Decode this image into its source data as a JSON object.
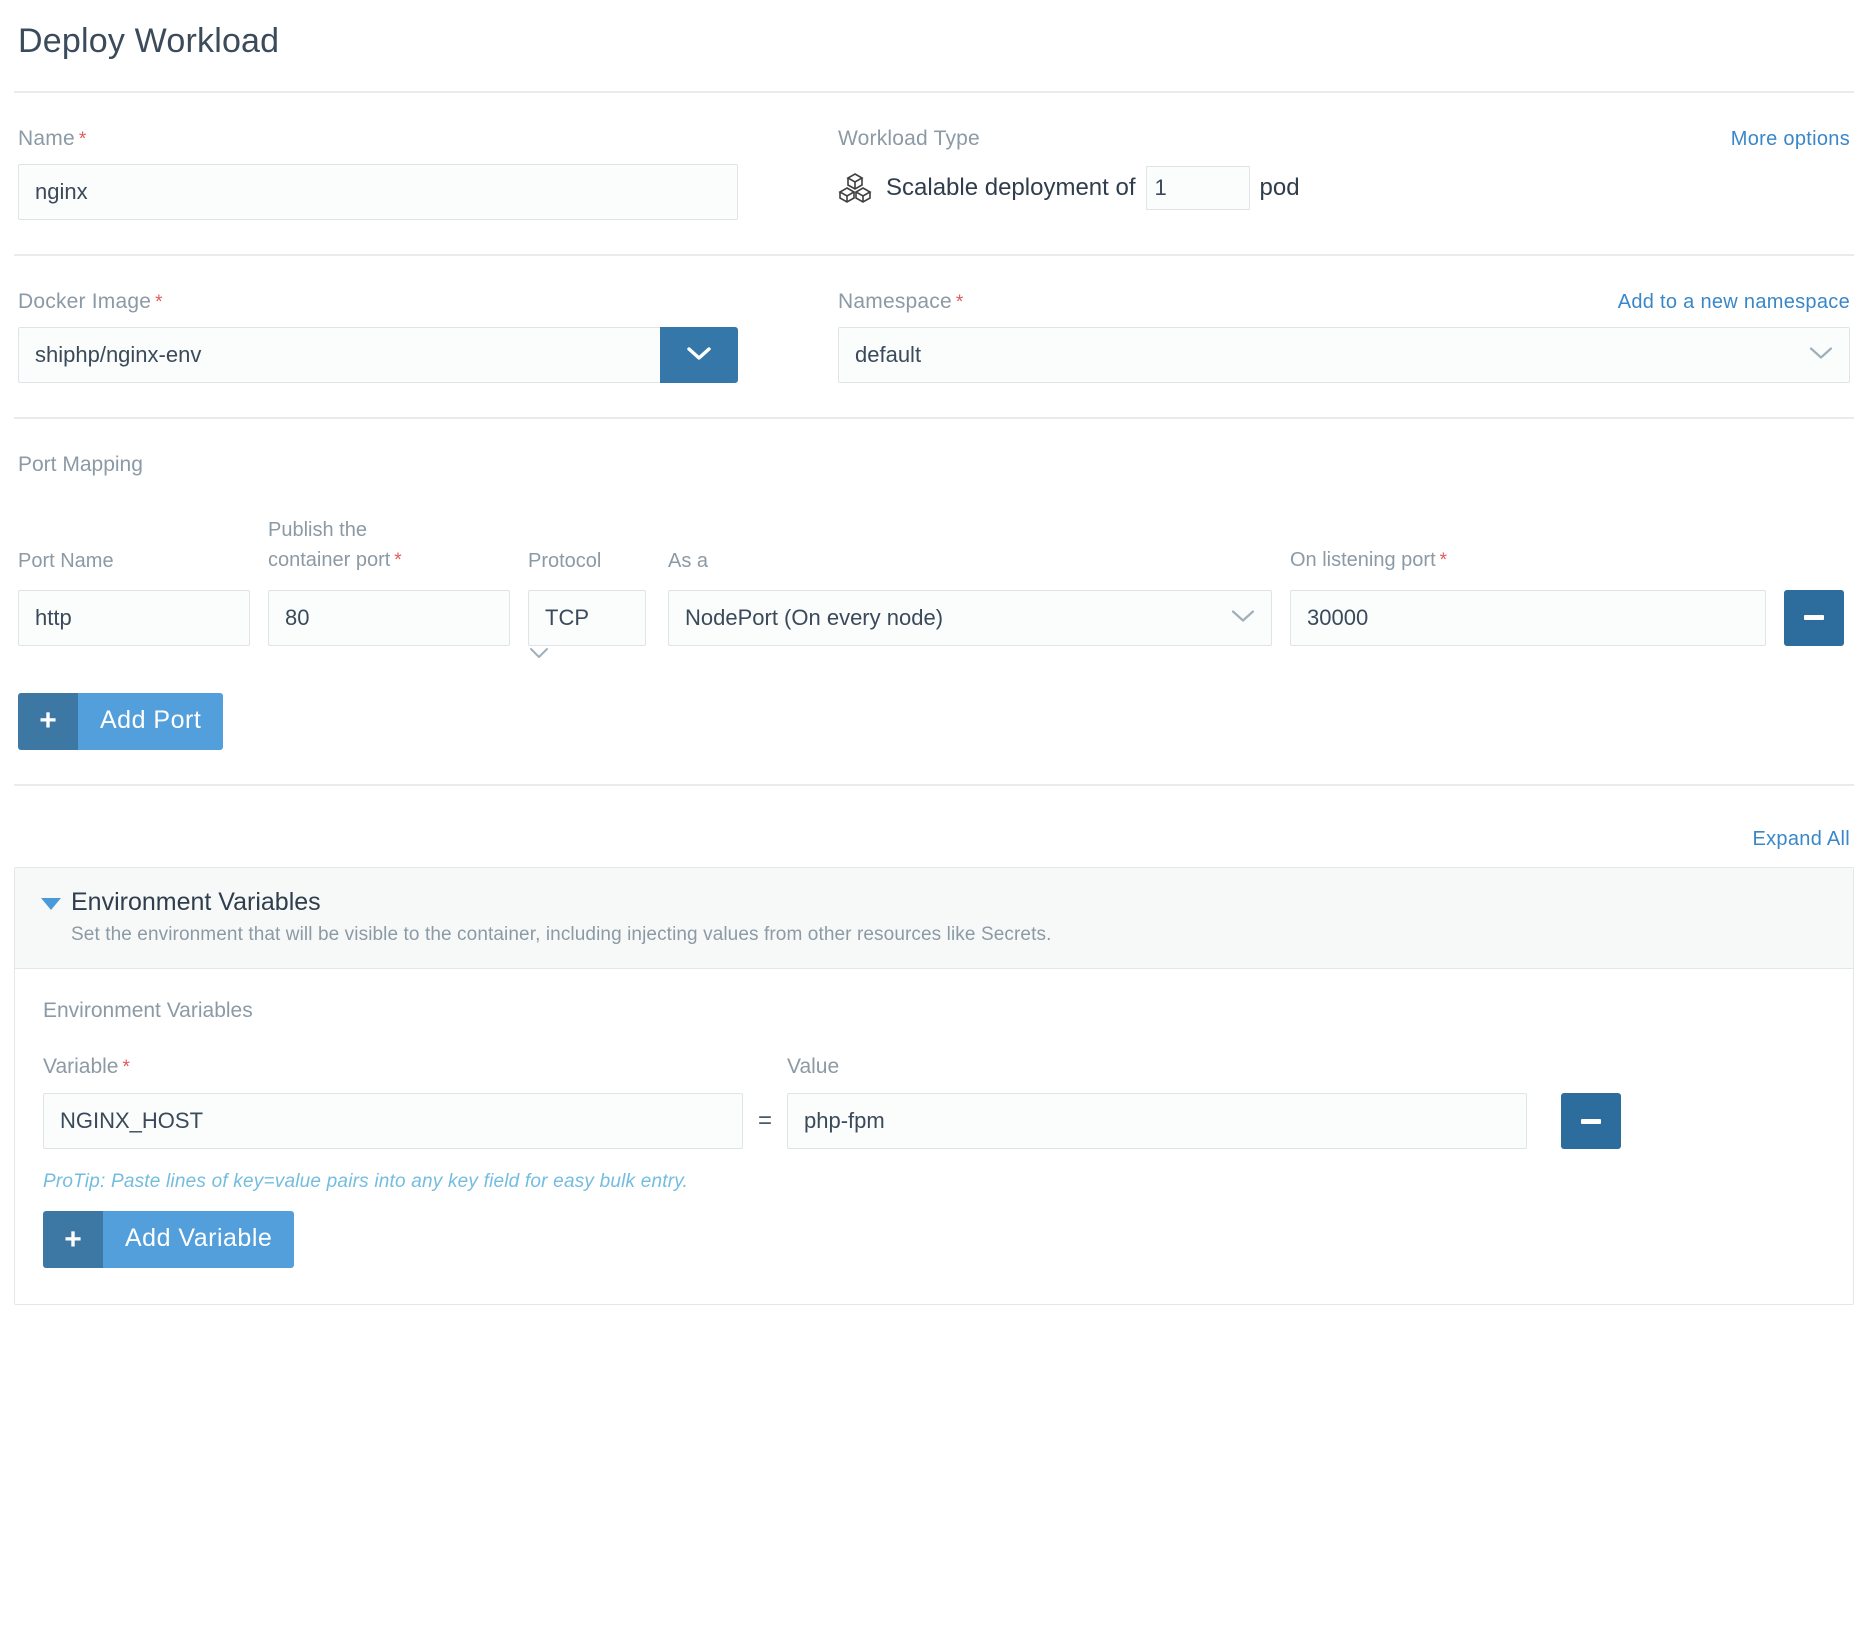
{
  "header": {
    "title": "Deploy Workload"
  },
  "name_section": {
    "label": "Name",
    "required_mark": "*",
    "value": "nginx"
  },
  "workload_type": {
    "label": "Workload Type",
    "more_options_link": "More options",
    "icon": "cubes-stack-icon",
    "text_before": "Scalable deployment of",
    "pods_value": "1",
    "text_after": "pod"
  },
  "docker_image": {
    "label": "Docker Image",
    "required_mark": "*",
    "value": "shiphp/nginx-env",
    "dropdown_icon": "chevron-down-icon"
  },
  "namespace": {
    "label": "Namespace",
    "required_mark": "*",
    "add_link": "Add to a new namespace",
    "value": "default"
  },
  "port_mapping": {
    "section_label": "Port Mapping",
    "headers": {
      "port_name": "Port Name",
      "container_port_line1": "Publish the",
      "container_port_line2": "container port",
      "container_port_required": "*",
      "protocol": "Protocol",
      "as_a": "As a",
      "listening_port": "On listening port",
      "listening_port_required": "*"
    },
    "rows": [
      {
        "port_name": "http",
        "container_port": "80",
        "protocol": "TCP",
        "as_a": "NodePort (On every node)",
        "listening_port": "30000",
        "remove_icon": "minus-icon"
      }
    ],
    "add_button": {
      "icon": "plus-icon",
      "label": "Add Port"
    }
  },
  "accordion": {
    "expand_all_link": "Expand All",
    "sections": [
      {
        "title": "Environment Variables",
        "description": "Set the environment that will be visible to the container, including injecting values from other resources like Secrets.",
        "expanded": true,
        "caret_icon": "caret-down-icon"
      }
    ]
  },
  "env_vars": {
    "section_label": "Environment Variables",
    "headers": {
      "variable": "Variable",
      "variable_required": "*",
      "value": "Value"
    },
    "equals": "=",
    "rows": [
      {
        "variable": "NGINX_HOST",
        "value": "php-fpm",
        "remove_icon": "minus-icon"
      }
    ],
    "protip": "ProTip: Paste lines of key=value pairs into any key field for easy bulk entry.",
    "add_button": {
      "icon": "plus-icon",
      "label": "Add Variable"
    }
  },
  "colors": {
    "accent_blue": "#3987c9",
    "button_blue": "#539fdc",
    "button_blue_dark": "#3d78a4",
    "combo_blue": "#3577a8",
    "minus_blue": "#2c6d9e",
    "required_red": "#e05c5c",
    "label_gray": "#8c9aa5",
    "protip_blue": "#72bde0"
  }
}
